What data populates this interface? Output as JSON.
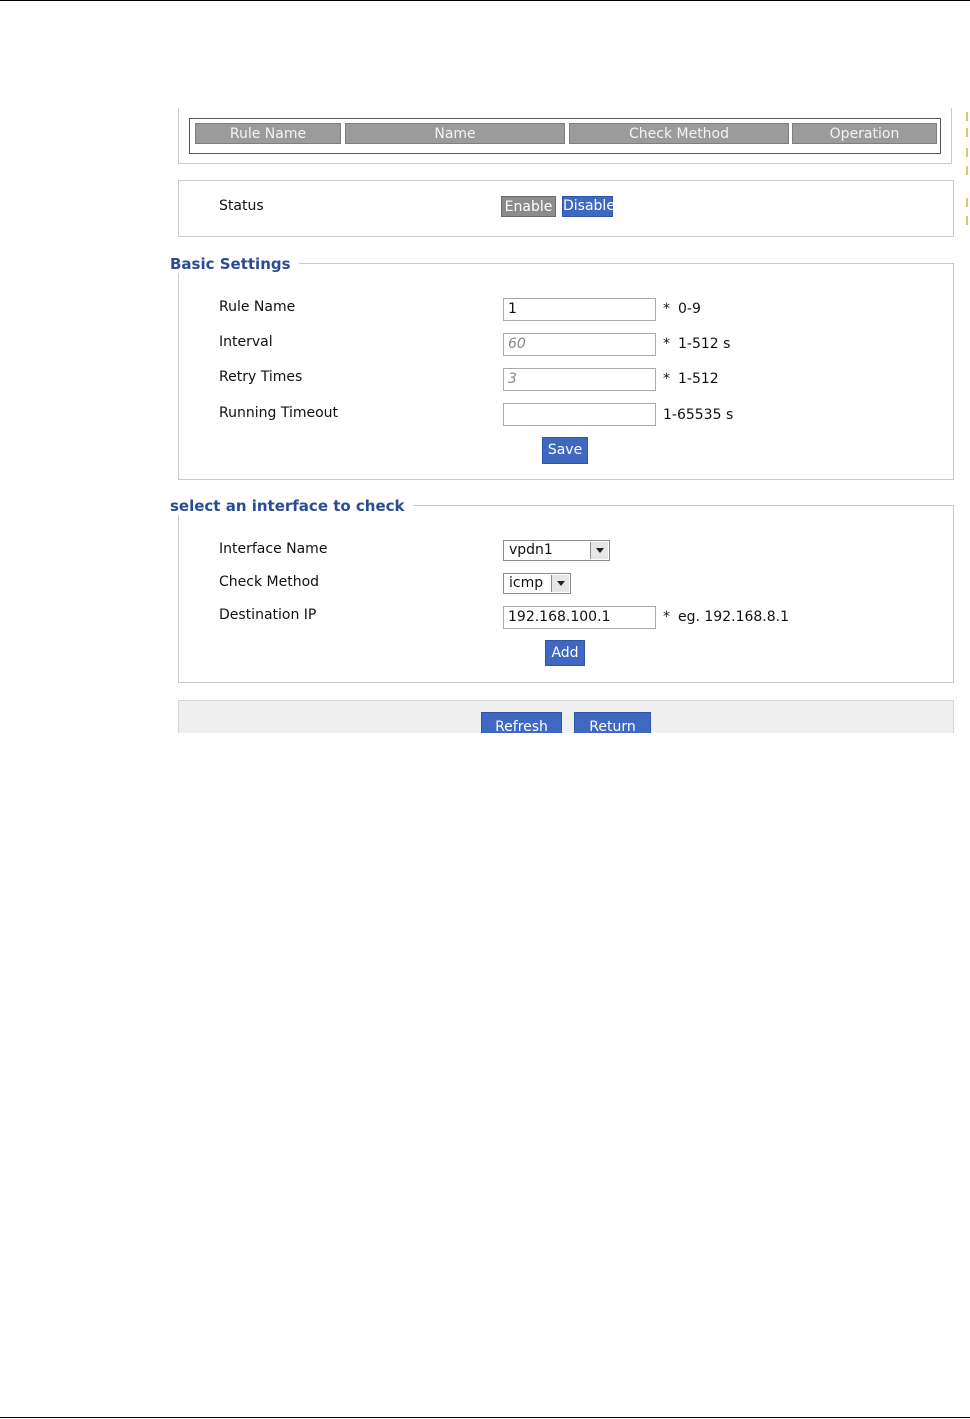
{
  "rules_table": {
    "columns": [
      "Rule Name",
      "Name",
      "Check Method",
      "Operation"
    ]
  },
  "status": {
    "label": "Status",
    "enable_label": "Enable",
    "disable_label": "Disable"
  },
  "basic_settings": {
    "legend": "Basic Settings",
    "rule_name": {
      "label": "Rule Name",
      "value": "1",
      "required": "*",
      "hint": "0-9"
    },
    "interval": {
      "label": "Interval",
      "placeholder": "60",
      "required": "*",
      "hint": "1-512 s"
    },
    "retry_times": {
      "label": "Retry Times",
      "placeholder": "3",
      "required": "*",
      "hint": "1-512"
    },
    "running_timeout": {
      "label": "Running Timeout",
      "value": "",
      "hint": "1-65535 s"
    },
    "save_label": "Save"
  },
  "interface_check": {
    "legend": "select an interface to check",
    "interface_name": {
      "label": "Interface Name",
      "selected": "vpdn1"
    },
    "check_method": {
      "label": "Check Method",
      "selected": "icmp"
    },
    "destination_ip": {
      "label": "Destination IP",
      "value": "192.168.100.1",
      "required": "*",
      "hint": "eg. 192.168.8.1"
    },
    "add_label": "Add"
  },
  "footer": {
    "refresh_label": "Refresh",
    "return_label": "Return"
  },
  "colors": {
    "accent_blue": "#3f68c0",
    "legend_blue": "#2a4c92",
    "header_gray": "#9b9b9b",
    "required_red": "#d32020"
  }
}
